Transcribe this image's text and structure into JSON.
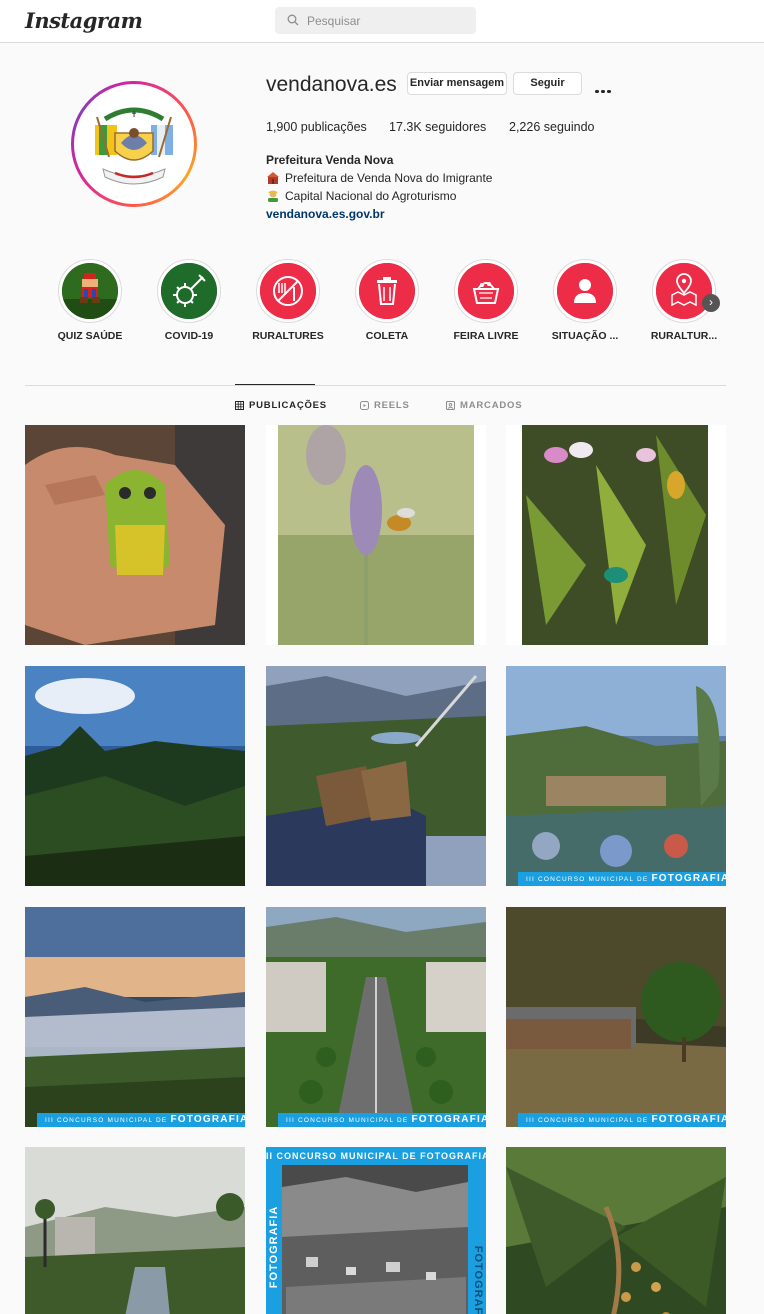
{
  "nav": {
    "logo": "Instagram",
    "search_placeholder": "Pesquisar"
  },
  "profile": {
    "username": "vendanova.es",
    "message_button": "Enviar mensagem",
    "follow_button": "Seguir",
    "stats": {
      "posts_count": "1,900",
      "posts_label": "publicações",
      "followers_count": "17.3K",
      "followers_label": "seguidores",
      "following_count": "2,226",
      "following_label": "seguindo"
    },
    "full_name": "Prefeitura Venda Nova",
    "bio_lines": [
      "Prefeitura de Venda Nova do Imigrante",
      "Capital Nacional do Agroturismo"
    ],
    "website": "vendanova.es.gov.br"
  },
  "highlights": [
    {
      "label": "QUIZ SAÚDE",
      "icon": "mario-character-icon"
    },
    {
      "label": "COVID-19",
      "icon": "virus-syringe-icon"
    },
    {
      "label": "RURALTURES",
      "icon": "no-food-icon"
    },
    {
      "label": "COLETA",
      "icon": "trash-can-icon"
    },
    {
      "label": "FEIRA LIVRE",
      "icon": "market-basket-icon"
    },
    {
      "label": "SITUAÇÃO ...",
      "icon": "person-icon"
    },
    {
      "label": "RURALTUR...",
      "icon": "map-pin-icon"
    }
  ],
  "tabs": [
    {
      "label": "PUBLICAÇÕES",
      "active": true
    },
    {
      "label": "REELS",
      "active": false
    },
    {
      "label": "MARCADOS",
      "active": false
    }
  ],
  "banner_text": {
    "small": "III CONCURSO MUNICIPAL DE",
    "big": "FOTOGRAFIA"
  },
  "colors": {
    "accent_red": "#ed2c48",
    "covid_green": "#1f6b2a",
    "link_blue": "#00376b",
    "contest_blue": "#1a9fe0"
  }
}
